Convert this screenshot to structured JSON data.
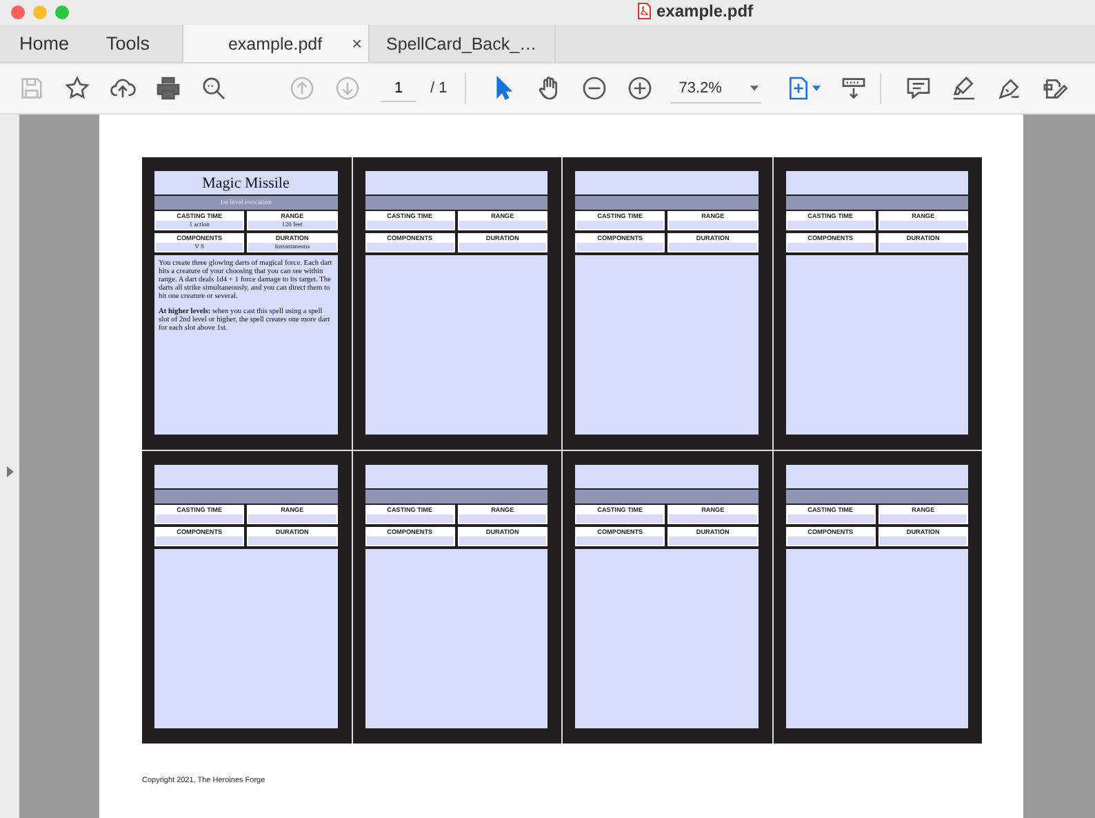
{
  "window": {
    "title": "example.pdf"
  },
  "nav": [
    {
      "label": "Home"
    },
    {
      "label": "Tools"
    }
  ],
  "doc_tabs": [
    {
      "label": "example.pdf",
      "selected": true,
      "close": "×"
    },
    {
      "label": "SpellCard_Back_…",
      "selected": false
    }
  ],
  "toolbar": {
    "left": [
      {
        "kind": "save",
        "disabled": true
      },
      {
        "kind": "star",
        "disabled": false
      },
      {
        "kind": "upload",
        "disabled": false
      },
      {
        "kind": "print",
        "disabled": false
      },
      {
        "kind": "search",
        "disabled": false
      },
      {
        "kind": "up",
        "disabled": true
      },
      {
        "kind": "down",
        "disabled": true
      }
    ],
    "page": "1",
    "total": "/ 1",
    "tools": [
      {
        "kind": "pointer",
        "selected": true
      },
      {
        "kind": "hand",
        "selected": false
      },
      {
        "kind": "minus",
        "selected": false
      },
      {
        "kind": "plus",
        "selected": false
      }
    ],
    "zoom": "73.2%",
    "view": [
      {
        "kind": "fit"
      },
      {
        "kind": "scroll"
      }
    ],
    "right": [
      {
        "kind": "comment"
      },
      {
        "kind": "highlight"
      },
      {
        "kind": "sign"
      },
      {
        "kind": "edit"
      }
    ]
  },
  "cards": [
    {
      "title": "Magic Missile",
      "subtitle": "1st level evocation",
      "fields": [
        {
          "label": "CASTING TIME",
          "value": "1 action"
        },
        {
          "label": "RANGE",
          "value": "120 feet"
        },
        {
          "label": "COMPONENTS",
          "value": "V S"
        },
        {
          "label": "DURATION",
          "value": "Instantaneous"
        }
      ],
      "description": [
        "You create three glowing darts of magical force. Each dart hits a creature of your choosing that you can see within range. A dart deals 1d4 + 1 force damage to its target. The darts all strike simultaneously, and you can direct them to hit one creature or several.",
        "**At higher levels:** when you cast this spell using a spell slot of 2nd level or higher, the spell creates one more dart for each slot above 1st."
      ]
    },
    {
      "fields": [
        {
          "label": "CASTING TIME"
        },
        {
          "label": "RANGE"
        },
        {
          "label": "COMPONENTS"
        },
        {
          "label": "DURATION"
        }
      ]
    },
    {
      "fields": [
        {
          "label": "CASTING TIME"
        },
        {
          "label": "RANGE"
        },
        {
          "label": "COMPONENTS"
        },
        {
          "label": "DURATION"
        }
      ]
    },
    {
      "fields": [
        {
          "label": "CASTING TIME"
        },
        {
          "label": "RANGE"
        },
        {
          "label": "COMPONENTS"
        },
        {
          "label": "DURATION"
        }
      ]
    },
    {
      "fields": [
        {
          "label": "CASTING TIME"
        },
        {
          "label": "RANGE"
        },
        {
          "label": "COMPONENTS"
        },
        {
          "label": "DURATION"
        }
      ]
    },
    {
      "fields": [
        {
          "label": "CASTING TIME"
        },
        {
          "label": "RANGE"
        },
        {
          "label": "COMPONENTS"
        },
        {
          "label": "DURATION"
        }
      ]
    },
    {
      "fields": [
        {
          "label": "CASTING TIME"
        },
        {
          "label": "RANGE"
        },
        {
          "label": "COMPONENTS"
        },
        {
          "label": "DURATION"
        }
      ]
    },
    {
      "fields": [
        {
          "label": "CASTING TIME"
        },
        {
          "label": "RANGE"
        },
        {
          "label": "COMPONENTS"
        },
        {
          "label": "DURATION"
        }
      ]
    }
  ],
  "footer": "Copyright 2021, The Heroines Forge"
}
